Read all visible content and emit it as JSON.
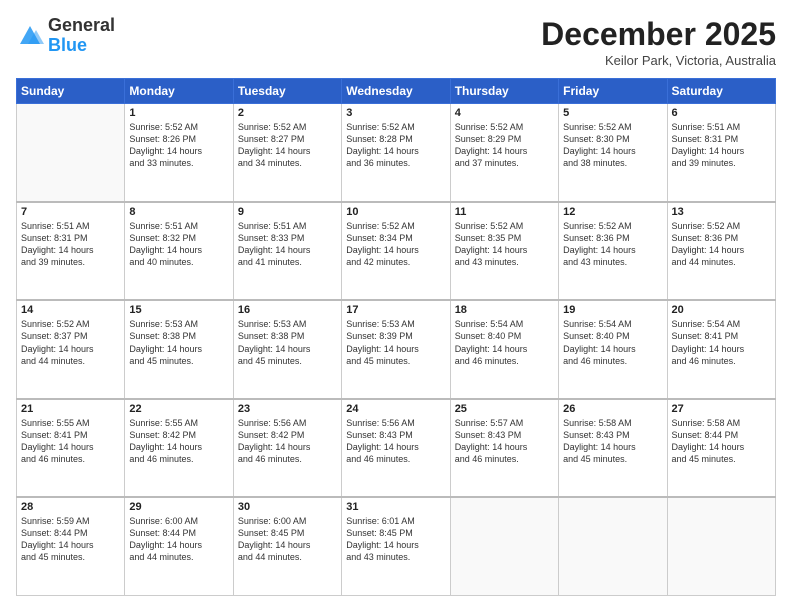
{
  "logo": {
    "general": "General",
    "blue": "Blue"
  },
  "header": {
    "month_title": "December 2025",
    "location": "Keilor Park, Victoria, Australia"
  },
  "days_of_week": [
    "Sunday",
    "Monday",
    "Tuesday",
    "Wednesday",
    "Thursday",
    "Friday",
    "Saturday"
  ],
  "weeks": [
    [
      {
        "day": "",
        "empty": true
      },
      {
        "day": "1",
        "sunrise": "5:52 AM",
        "sunset": "8:26 PM",
        "daylight": "14 hours and 33 minutes."
      },
      {
        "day": "2",
        "sunrise": "5:52 AM",
        "sunset": "8:27 PM",
        "daylight": "14 hours and 34 minutes."
      },
      {
        "day": "3",
        "sunrise": "5:52 AM",
        "sunset": "8:28 PM",
        "daylight": "14 hours and 36 minutes."
      },
      {
        "day": "4",
        "sunrise": "5:52 AM",
        "sunset": "8:29 PM",
        "daylight": "14 hours and 37 minutes."
      },
      {
        "day": "5",
        "sunrise": "5:52 AM",
        "sunset": "8:30 PM",
        "daylight": "14 hours and 38 minutes."
      },
      {
        "day": "6",
        "sunrise": "5:51 AM",
        "sunset": "8:31 PM",
        "daylight": "14 hours and 39 minutes."
      }
    ],
    [
      {
        "day": "7",
        "sunrise": "5:51 AM",
        "sunset": "8:31 PM",
        "daylight": "14 hours and 39 minutes."
      },
      {
        "day": "8",
        "sunrise": "5:51 AM",
        "sunset": "8:32 PM",
        "daylight": "14 hours and 40 minutes."
      },
      {
        "day": "9",
        "sunrise": "5:51 AM",
        "sunset": "8:33 PM",
        "daylight": "14 hours and 41 minutes."
      },
      {
        "day": "10",
        "sunrise": "5:52 AM",
        "sunset": "8:34 PM",
        "daylight": "14 hours and 42 minutes."
      },
      {
        "day": "11",
        "sunrise": "5:52 AM",
        "sunset": "8:35 PM",
        "daylight": "14 hours and 43 minutes."
      },
      {
        "day": "12",
        "sunrise": "5:52 AM",
        "sunset": "8:36 PM",
        "daylight": "14 hours and 43 minutes."
      },
      {
        "day": "13",
        "sunrise": "5:52 AM",
        "sunset": "8:36 PM",
        "daylight": "14 hours and 44 minutes."
      }
    ],
    [
      {
        "day": "14",
        "sunrise": "5:52 AM",
        "sunset": "8:37 PM",
        "daylight": "14 hours and 44 minutes."
      },
      {
        "day": "15",
        "sunrise": "5:53 AM",
        "sunset": "8:38 PM",
        "daylight": "14 hours and 45 minutes."
      },
      {
        "day": "16",
        "sunrise": "5:53 AM",
        "sunset": "8:38 PM",
        "daylight": "14 hours and 45 minutes."
      },
      {
        "day": "17",
        "sunrise": "5:53 AM",
        "sunset": "8:39 PM",
        "daylight": "14 hours and 45 minutes."
      },
      {
        "day": "18",
        "sunrise": "5:54 AM",
        "sunset": "8:40 PM",
        "daylight": "14 hours and 46 minutes."
      },
      {
        "day": "19",
        "sunrise": "5:54 AM",
        "sunset": "8:40 PM",
        "daylight": "14 hours and 46 minutes."
      },
      {
        "day": "20",
        "sunrise": "5:54 AM",
        "sunset": "8:41 PM",
        "daylight": "14 hours and 46 minutes."
      }
    ],
    [
      {
        "day": "21",
        "sunrise": "5:55 AM",
        "sunset": "8:41 PM",
        "daylight": "14 hours and 46 minutes."
      },
      {
        "day": "22",
        "sunrise": "5:55 AM",
        "sunset": "8:42 PM",
        "daylight": "14 hours and 46 minutes."
      },
      {
        "day": "23",
        "sunrise": "5:56 AM",
        "sunset": "8:42 PM",
        "daylight": "14 hours and 46 minutes."
      },
      {
        "day": "24",
        "sunrise": "5:56 AM",
        "sunset": "8:43 PM",
        "daylight": "14 hours and 46 minutes."
      },
      {
        "day": "25",
        "sunrise": "5:57 AM",
        "sunset": "8:43 PM",
        "daylight": "14 hours and 46 minutes."
      },
      {
        "day": "26",
        "sunrise": "5:58 AM",
        "sunset": "8:43 PM",
        "daylight": "14 hours and 45 minutes."
      },
      {
        "day": "27",
        "sunrise": "5:58 AM",
        "sunset": "8:44 PM",
        "daylight": "14 hours and 45 minutes."
      }
    ],
    [
      {
        "day": "28",
        "sunrise": "5:59 AM",
        "sunset": "8:44 PM",
        "daylight": "14 hours and 45 minutes."
      },
      {
        "day": "29",
        "sunrise": "6:00 AM",
        "sunset": "8:44 PM",
        "daylight": "14 hours and 44 minutes."
      },
      {
        "day": "30",
        "sunrise": "6:00 AM",
        "sunset": "8:45 PM",
        "daylight": "14 hours and 44 minutes."
      },
      {
        "day": "31",
        "sunrise": "6:01 AM",
        "sunset": "8:45 PM",
        "daylight": "14 hours and 43 minutes."
      },
      {
        "day": "",
        "empty": true
      },
      {
        "day": "",
        "empty": true
      },
      {
        "day": "",
        "empty": true
      }
    ]
  ],
  "labels": {
    "sunrise": "Sunrise:",
    "sunset": "Sunset:",
    "daylight": "Daylight:"
  }
}
